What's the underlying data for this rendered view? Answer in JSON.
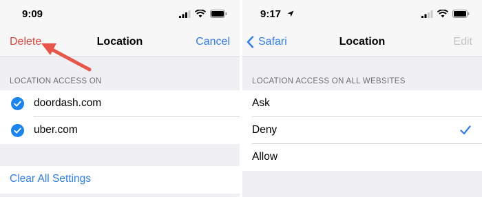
{
  "left": {
    "status": {
      "time": "9:09"
    },
    "nav": {
      "left_button": "Delete",
      "title": "Location",
      "right_button": "Cancel"
    },
    "section_header": "LOCATION ACCESS ON",
    "sites": [
      {
        "label": "doordash.com",
        "checked": true
      },
      {
        "label": "uber.com",
        "checked": true
      }
    ],
    "clear_all": "Clear All Settings"
  },
  "right": {
    "status": {
      "time": "9:17"
    },
    "nav": {
      "back_label": "Safari",
      "title": "Location",
      "right_button": "Edit"
    },
    "section_header": "LOCATION ACCESS ON ALL WEBSITES",
    "options": [
      {
        "label": "Ask",
        "selected": false
      },
      {
        "label": "Deny",
        "selected": true
      },
      {
        "label": "Allow",
        "selected": false
      }
    ]
  },
  "colors": {
    "accent": "#2f7df6",
    "delete_red": "#e0463b",
    "annotation_arrow": "#e8564a",
    "disabled": "#c4c4c8"
  }
}
